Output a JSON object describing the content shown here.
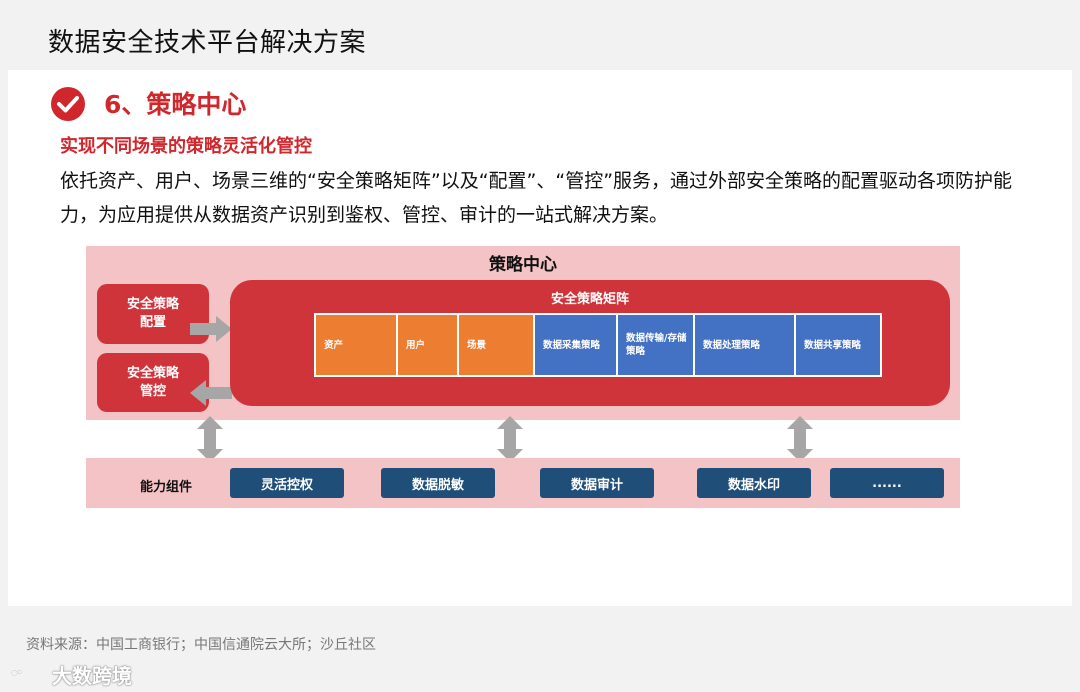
{
  "header": {
    "title": "数据安全技术平台解决方案"
  },
  "section": {
    "title": "6、策略中心",
    "subtitle": "实现不同场景的策略灵活化管控",
    "description": "依托资产、用户、场景三维的“安全策略矩阵”以及“配置”、“管控”服务，通过外部安全策略的配置驱动各项防护能力，为应用提供从数据资产识别到鉴权、管控、审计的一站式解决方案。"
  },
  "diagram": {
    "center_title": "策略中心",
    "config_box": "安全策略配置",
    "control_box": "安全策略管控",
    "matrix_title": "安全策略矩阵",
    "matrix_cells": [
      {
        "label": "资产",
        "color": "#ec7d31"
      },
      {
        "label": "用户",
        "color": "#ec7d31"
      },
      {
        "label": "场景",
        "color": "#ec7d31"
      },
      {
        "label": "数据采集策略",
        "color": "#4371c4"
      },
      {
        "label": "数据传输/存储策略",
        "color": "#4371c4"
      },
      {
        "label": "数据处理策略",
        "color": "#4371c4"
      },
      {
        "label": "数据共享策略",
        "color": "#4371c4"
      }
    ],
    "ability_label": "能力组件",
    "capabilities": [
      "灵活控权",
      "数据脱敏",
      "数据审计",
      "数据水印",
      "......"
    ]
  },
  "footer": {
    "source": "资料来源：中国工商银行；中国信通院云大所；沙丘社区",
    "watermark": "大数跨境"
  },
  "colors": {
    "accent_red": "#d0272d",
    "panel_pink": "#f3c3c5",
    "box_red": "#d0343b",
    "cell_orange": "#ec7d31",
    "cell_blue": "#4371c4",
    "cap_navy": "#1f4e79",
    "arrow_gray": "#a6a6a6"
  }
}
